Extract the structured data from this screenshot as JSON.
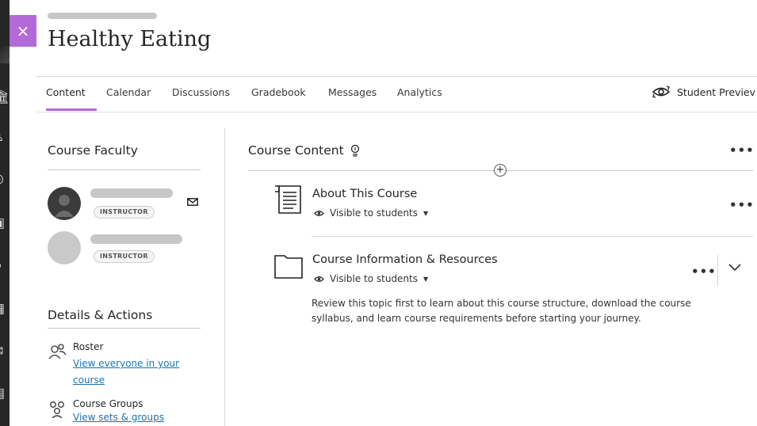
{
  "course": {
    "title": "Healthy Eating"
  },
  "close": {
    "glyph": "×"
  },
  "accent_color": "#b36ad8",
  "link_color": "#1a73b8",
  "nav": {
    "tabs": [
      {
        "label": "Content",
        "active": true
      },
      {
        "label": "Calendar"
      },
      {
        "label": "Discussions"
      },
      {
        "label": "Gradebook"
      },
      {
        "label": "Messages"
      },
      {
        "label": "Analytics"
      }
    ],
    "student_preview_label": "Student Previev"
  },
  "left_rail_icons": [
    "institution-icon",
    "user-icon",
    "globe-icon",
    "courses-icon",
    "groups-icon",
    "calendar-icon",
    "mail-icon",
    "grades-icon"
  ],
  "faculty": {
    "heading": "Course Faculty",
    "members": [
      {
        "role": "INSTRUCTOR"
      },
      {
        "role": "INSTRUCTOR"
      }
    ]
  },
  "details": {
    "heading": "Details & Actions",
    "items": [
      {
        "label": "Roster",
        "link_lines": [
          "View everyone in your",
          "course"
        ],
        "icon": "roster-icon"
      },
      {
        "label": "Course Groups",
        "link_lines": [
          "View sets & groups"
        ],
        "icon": "groups-icon"
      }
    ]
  },
  "content": {
    "heading": "Course Content",
    "items": [
      {
        "title": "About This Course",
        "visibility": "Visible to students",
        "icon": "document-icon"
      },
      {
        "title": "Course Information & Resources",
        "visibility": "Visible to students",
        "icon": "folder-icon",
        "description": "Review this topic first to learn about this course structure, download the course syllabus, and learn course requirements before starting your journey."
      }
    ]
  }
}
